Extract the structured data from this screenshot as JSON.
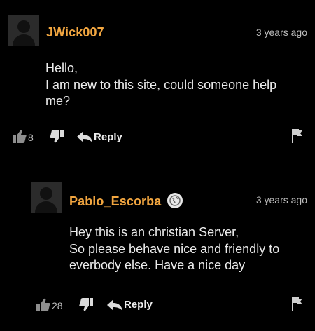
{
  "comments": [
    {
      "username": "JWick007",
      "time": "3 years ago",
      "text_lines": [
        "Hello,",
        "I am new to this site, could someone help",
        "me?"
      ],
      "likes": "8",
      "reply_label": "Reply"
    },
    {
      "username": "Pablo_Escorba",
      "time": "3 years ago",
      "text_lines": [
        "Hey this is an christian Server,",
        "So please behave nice and friendly to",
        "everbody else. Have a nice day"
      ],
      "likes": "28",
      "reply_label": "Reply"
    }
  ],
  "colors": {
    "background": "#000000",
    "username": "#f2a640",
    "muted": "#bdbdbd"
  },
  "icons": {
    "like": "thumbs-up-icon",
    "dislike": "thumbs-down-icon",
    "reply": "reply-arrow-icon",
    "flag": "flag-icon",
    "badge": "globe-badge-icon"
  }
}
